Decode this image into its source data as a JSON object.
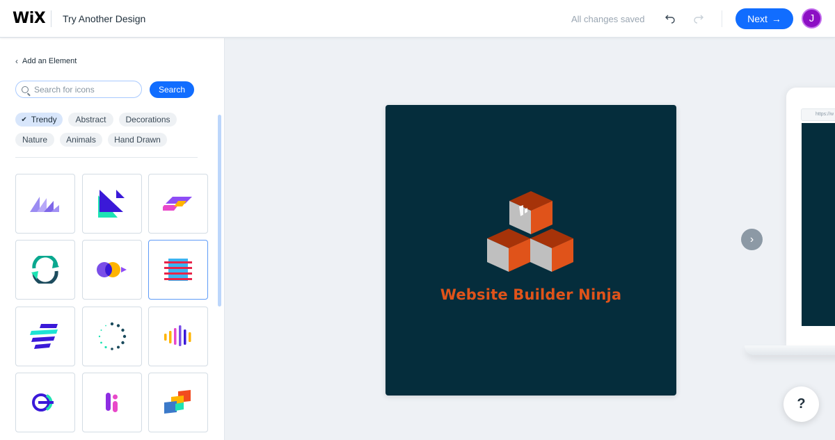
{
  "header": {
    "logo": "WiX",
    "title": "Try Another Design",
    "save_status": "All changes saved",
    "undo_icon": "undo-icon",
    "redo_icon": "redo-icon",
    "next_label": "Next",
    "avatar_initial": "J",
    "colors": {
      "primary": "#116dff",
      "avatar": "#8c0fc4"
    }
  },
  "panel": {
    "back_label": "Add an Element",
    "search": {
      "placeholder": "Search for icons",
      "value": ""
    },
    "search_button": "Search",
    "filters": [
      {
        "label": "Trendy",
        "selected": true
      },
      {
        "label": "Abstract",
        "selected": false
      },
      {
        "label": "Decorations",
        "selected": false
      },
      {
        "label": "Nature",
        "selected": false
      },
      {
        "label": "Animals",
        "selected": false
      },
      {
        "label": "Hand Drawn",
        "selected": false
      }
    ],
    "icons": [
      {
        "name": "layered-peaks-icon",
        "selected": false
      },
      {
        "name": "geometric-triangles-icon",
        "selected": false
      },
      {
        "name": "parallelogram-stack-icon",
        "selected": false
      },
      {
        "name": "circular-arrows-icon",
        "selected": false
      },
      {
        "name": "fish-circles-icon",
        "selected": false
      },
      {
        "name": "striped-square-icon",
        "selected": true
      },
      {
        "name": "diagonal-bars-icon",
        "selected": false
      },
      {
        "name": "dotted-circle-icon",
        "selected": false
      },
      {
        "name": "equalizer-bars-icon",
        "selected": false
      },
      {
        "name": "ring-arrow-icon",
        "selected": false
      },
      {
        "name": "letter-i-icon",
        "selected": false
      },
      {
        "name": "overlapping-squares-icon",
        "selected": false
      }
    ]
  },
  "canvas": {
    "brand_name": "Website Builder Ninja",
    "card_color": "#052d3c",
    "brand_color": "#e0531a",
    "preview_url": "https://w",
    "next_arrow_icon": "chevron-right-icon",
    "help_label": "?"
  }
}
